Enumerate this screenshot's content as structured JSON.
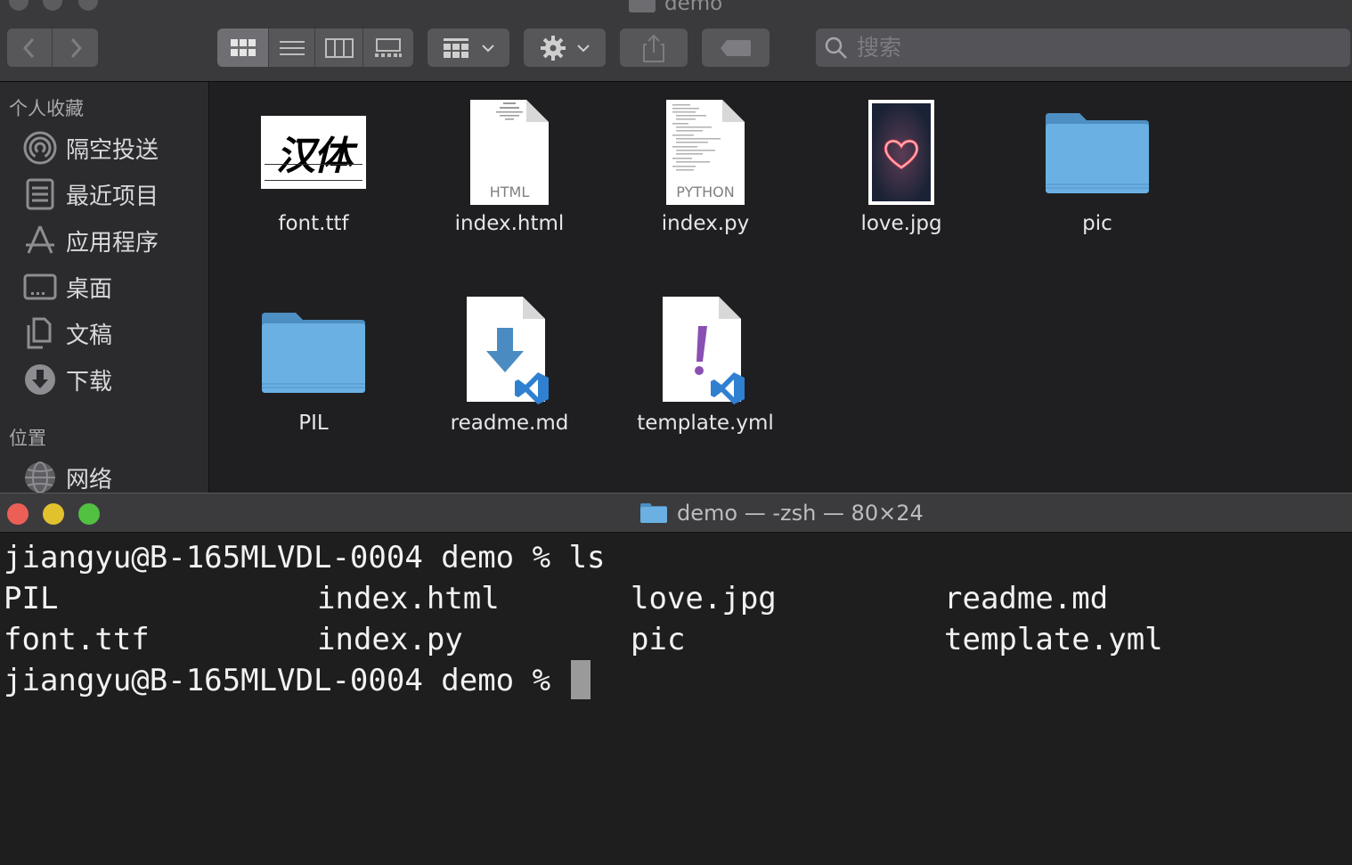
{
  "finder": {
    "title": "demo",
    "search_placeholder": "搜索",
    "sidebar": {
      "favorites_header": "个人收藏",
      "favorites": [
        {
          "label": "隔空投送",
          "icon": "airdrop-icon"
        },
        {
          "label": "最近项目",
          "icon": "recents-icon"
        },
        {
          "label": "应用程序",
          "icon": "applications-icon"
        },
        {
          "label": "桌面",
          "icon": "desktop-icon"
        },
        {
          "label": "文稿",
          "icon": "documents-icon"
        },
        {
          "label": "下载",
          "icon": "downloads-icon"
        }
      ],
      "locations_header": "位置",
      "locations": [
        {
          "label": "网络",
          "icon": "network-icon"
        }
      ]
    },
    "files": [
      {
        "name": "font.ttf",
        "icon": "font-preview-icon",
        "preview_text": "汉体"
      },
      {
        "name": "index.html",
        "icon": "html-file-icon",
        "badge": "HTML"
      },
      {
        "name": "index.py",
        "icon": "python-file-icon",
        "badge": "PYTHON"
      },
      {
        "name": "love.jpg",
        "icon": "image-thumbnail-icon"
      },
      {
        "name": "pic",
        "icon": "folder-icon"
      },
      {
        "name": "PIL",
        "icon": "folder-icon"
      },
      {
        "name": "readme.md",
        "icon": "markdown-file-icon"
      },
      {
        "name": "template.yml",
        "icon": "yaml-file-icon"
      }
    ]
  },
  "terminal": {
    "title": "demo — -zsh — 80×24",
    "prompt": "jiangyu@B-165MLVDL-0004 demo % ",
    "command": "ls",
    "output_rows": [
      [
        "PIL",
        "index.html",
        "love.jpg",
        "readme.md"
      ],
      [
        "font.ttf",
        "index.py",
        "pic",
        "template.yml"
      ]
    ]
  },
  "colors": {
    "close": "#ec5f57",
    "minimize": "#e2c12e",
    "zoom": "#52c041",
    "folder": "#6ab0e2"
  }
}
